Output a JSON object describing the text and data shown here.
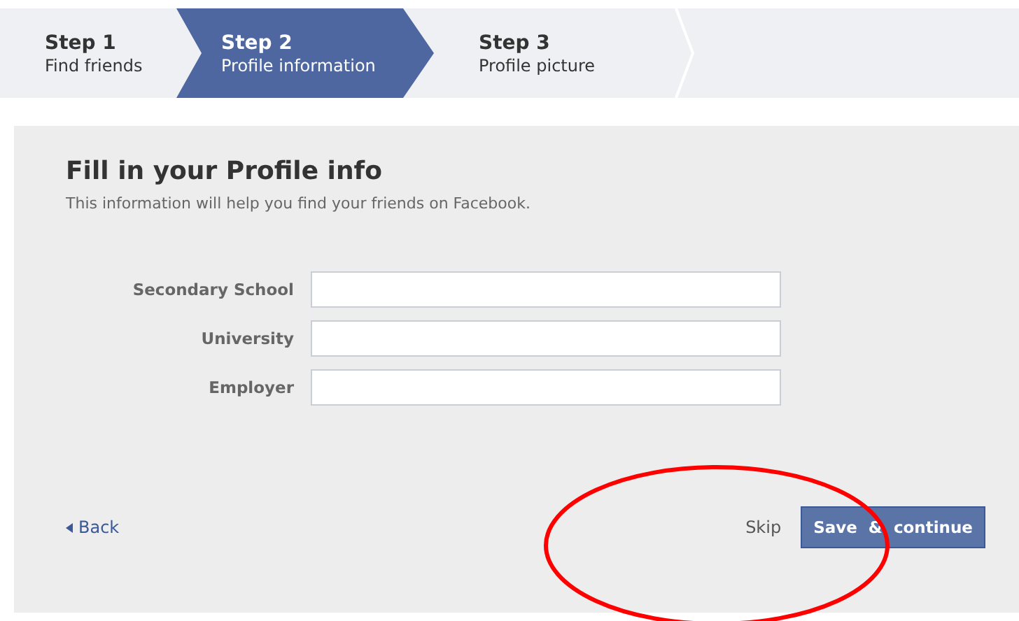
{
  "steps": [
    {
      "number": "Step 1",
      "label": "Find friends",
      "selected": false
    },
    {
      "number": "Step 2",
      "label": "Profile information",
      "selected": true
    },
    {
      "number": "Step 3",
      "label": "Profile picture",
      "selected": false
    }
  ],
  "form": {
    "title": "Fill in your Profile info",
    "subtitle": "This information will help you find your friends on Facebook.",
    "fields": [
      {
        "label": "Secondary School"
      },
      {
        "label": "University"
      },
      {
        "label": "Employer"
      }
    ]
  },
  "footer": {
    "back": "Back",
    "skip": "Skip",
    "submit": "Save & continue"
  }
}
